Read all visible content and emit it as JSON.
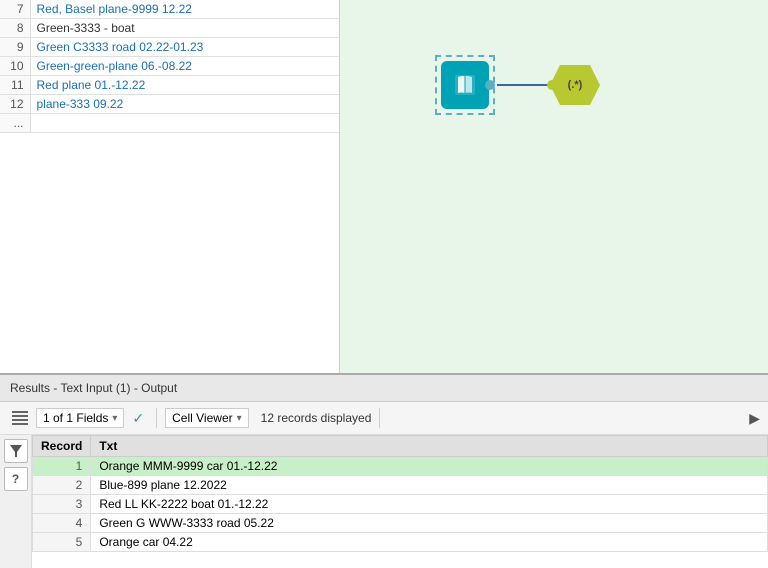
{
  "leftTable": {
    "rows": [
      {
        "num": "7",
        "text": "Red, Basel plane-9999 12.22",
        "style": "normal"
      },
      {
        "num": "8",
        "text": "Green-3333 - boat",
        "style": "plain"
      },
      {
        "num": "9",
        "text": "Green C3333 road 02.22-01.23",
        "style": "normal"
      },
      {
        "num": "10",
        "text": "Green-green-plane 06.-08.22",
        "style": "normal"
      },
      {
        "num": "11",
        "text": "Red plane 01.-12.22",
        "style": "normal"
      },
      {
        "num": "12",
        "text": "plane-333 09.22",
        "style": "normal"
      },
      {
        "num": "...",
        "text": "",
        "style": "plain"
      }
    ]
  },
  "canvas": {
    "nodeBook": {
      "label": "Text Input"
    },
    "nodeRegex": {
      "label": "(.*)"
    }
  },
  "results": {
    "header": "Results - Text Input (1) - Output",
    "toolbar": {
      "fieldsLabel": "1 of 1 Fields",
      "fieldsDropdown": "▾",
      "checkmark": "✓",
      "viewerLabel": "Cell Viewer",
      "viewerDropdown": "▾",
      "recordsCount": "12 records displayed"
    },
    "columns": [
      {
        "key": "record",
        "label": "Record"
      },
      {
        "key": "txt",
        "label": "Txt"
      }
    ],
    "rows": [
      {
        "num": "1",
        "text": "Orange MMM-9999 car 01.-12.22",
        "highlighted": true
      },
      {
        "num": "2",
        "text": "Blue-899 plane 12.2022",
        "highlighted": false
      },
      {
        "num": "3",
        "text": "Red LL KK-2222 boat  01.-12.22",
        "highlighted": false
      },
      {
        "num": "4",
        "text": "Green G WWW-3333 road 05.22",
        "highlighted": false
      },
      {
        "num": "5",
        "text": "Orange car 04.22",
        "highlighted": false
      }
    ]
  }
}
